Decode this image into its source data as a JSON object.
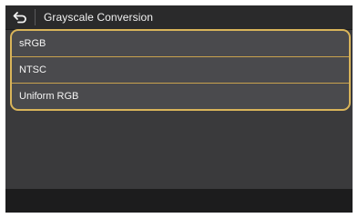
{
  "header": {
    "back_icon": "back-arrow-icon",
    "title": "Grayscale Conversion"
  },
  "options": [
    {
      "label": "sRGB"
    },
    {
      "label": "NTSC"
    },
    {
      "label": "Uniform RGB"
    }
  ],
  "colors": {
    "accent": "#d9b45a",
    "screen_bg": "#3a3a3c",
    "header_bg": "#2a2a2b",
    "list_bg": "#4a4a4d"
  }
}
